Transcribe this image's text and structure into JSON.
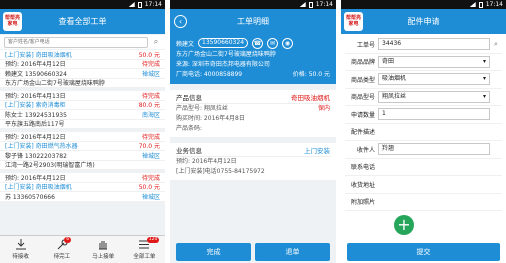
{
  "status_time": "17:14",
  "app_logo": {
    "line1": "帮帮亮",
    "line2": "家电"
  },
  "screen1": {
    "title": "查看全部工单",
    "search_placeholder": "客户姓名/客户电话",
    "orders": [
      {
        "rows": [
          {
            "l": "[上门安装] 奇田吸油烟机",
            "lc": "blue",
            "r": "50.0 元",
            "rc": "red"
          },
          {
            "l": "预约: 2016年4月12日",
            "lc": "gray",
            "r": "待完成",
            "rc": "red"
          },
          {
            "l": "赖建文  13590660324",
            "lc": "gray",
            "r": "禅城区",
            "rc": "blue"
          },
          {
            "l": "东方广场金山二街7号玻璃屋烧味鸭脖",
            "lc": "gray",
            "r": "",
            "rc": "gray"
          }
        ]
      },
      {
        "rows": [
          {
            "l": "预约: 2016年4月13日",
            "lc": "gray",
            "r": "待完成",
            "rc": "red"
          },
          {
            "l": "[上门安装] 索奇消毒柜",
            "lc": "blue",
            "r": "80.0 元",
            "rc": "red"
          },
          {
            "l": "陈女士  13924531935",
            "lc": "gray",
            "r": "南海区",
            "rc": "blue"
          },
          {
            "l": "平东旗五路南后117号",
            "lc": "gray",
            "r": "",
            "rc": "gray"
          }
        ]
      },
      {
        "rows": [
          {
            "l": "预约: 2016年4月12日",
            "lc": "gray",
            "r": "待完成",
            "rc": "red"
          },
          {
            "l": "[上门安装] 奇田燃气热水器",
            "lc": "blue",
            "r": "70.0 元",
            "rc": "red"
          },
          {
            "l": "黎子锋  13022203782",
            "lc": "gray",
            "r": "禅城区",
            "rc": "blue"
          },
          {
            "l": "江湾一路2号2903(明瑞智富广场)",
            "lc": "gray",
            "r": "",
            "rc": "gray"
          }
        ]
      },
      {
        "rows": [
          {
            "l": "预约: 2016年4月12日",
            "lc": "gray",
            "r": "待完成",
            "rc": "red"
          },
          {
            "l": "[上门安装] 奇田吸油烟机",
            "lc": "blue",
            "r": "50.0 元",
            "rc": "red"
          },
          {
            "l": "苏  13360570666",
            "lc": "gray",
            "r": "禅城区",
            "rc": "blue"
          }
        ]
      }
    ],
    "nav": [
      {
        "label": "待接收",
        "badge": "",
        "icon": "download-icon"
      },
      {
        "label": "待完工",
        "badge": "6",
        "icon": "wrench-icon"
      },
      {
        "label": "马上接单",
        "badge": "",
        "icon": "hand-icon"
      },
      {
        "label": "全部工单",
        "badge": "120",
        "icon": "list-icon"
      }
    ]
  },
  "screen2": {
    "title": "工单明细",
    "customer_name": "赖建文",
    "customer_phone": "13590660324",
    "address_line": "东方广场金山二街7号玻璃屋烧味鸭脖",
    "source_line": "来源: 深圳市奇田杰邦电器有限公司",
    "factory_phone": "厂商电话: 4000858899",
    "price": "价格: 50.0 元",
    "product_title": "产品信息",
    "product_brand": "奇田吸油烟机",
    "product_model_label": "产品型号: 翔凤拉丝",
    "product_warranty": "保内",
    "purchase_date": "购买时间: 2016年4月8日",
    "barcode": "产品条码:",
    "service_title": "业务信息",
    "service_type": "上门安装",
    "appointment": "预约: 2016年4月12日",
    "hotline": "[上门安装]电话0755-84175972",
    "btn_complete": "完成",
    "btn_return": "退单"
  },
  "screen3": {
    "title": "配件申请",
    "fields": [
      {
        "label": "工单号",
        "value": "34436",
        "type": "input",
        "icon": "search-icon"
      },
      {
        "label": "商品品牌",
        "value": "奇田",
        "type": "select",
        "icon": ""
      },
      {
        "label": "商品类型",
        "value": "吸油烟机",
        "type": "select",
        "icon": ""
      },
      {
        "label": "商品型号",
        "value": "翔凤拉丝",
        "type": "select",
        "icon": ""
      },
      {
        "label": "申请数量",
        "value": "1",
        "type": "input",
        "icon": ""
      },
      {
        "label": "配件描述",
        "value": "",
        "type": "plain",
        "icon": ""
      },
      {
        "label": "收件人",
        "value": "羚翘",
        "type": "input",
        "icon": ""
      },
      {
        "label": "联系电话",
        "value": "",
        "type": "plain",
        "icon": ""
      },
      {
        "label": "收货地址",
        "value": "",
        "type": "plain",
        "icon": ""
      },
      {
        "label": "附加照片",
        "value": "",
        "type": "plain",
        "icon": ""
      }
    ],
    "submit": "提交"
  },
  "colors": {
    "primary": "#1f8dd6",
    "danger": "#e01818",
    "add": "#26a65b"
  }
}
